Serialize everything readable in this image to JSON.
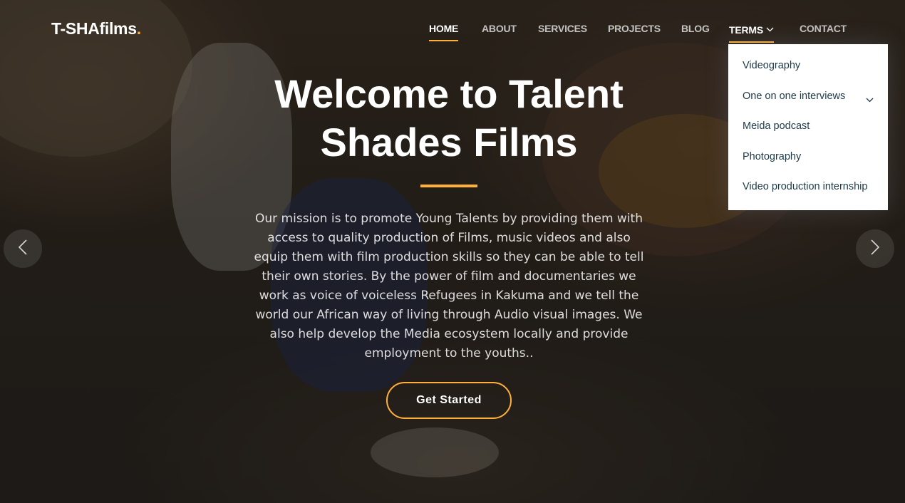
{
  "brand": {
    "name": "T-SHAfilms",
    "dot": ".",
    "accent": "#ffb03b"
  },
  "nav": {
    "items": [
      {
        "label": "HOME",
        "active": true
      },
      {
        "label": "ABOUT",
        "active": false
      },
      {
        "label": "SERVICES",
        "active": false
      },
      {
        "label": "PROJECTS",
        "active": false
      },
      {
        "label": "BLOG",
        "active": false
      },
      {
        "label": "TERMS",
        "active": false,
        "dropdown": true
      },
      {
        "label": "CONTACT",
        "active": false
      }
    ]
  },
  "dropdown": {
    "items": [
      {
        "label": "Videography"
      },
      {
        "label": "One on one interviews",
        "has_submenu": true
      },
      {
        "label": "Meida podcast"
      },
      {
        "label": "Photography"
      },
      {
        "label": "Video production internship"
      }
    ]
  },
  "hero": {
    "title_line1": "Welcome to Talent",
    "title_line2": "Shades Films",
    "mission": "Our mission is to promote Young Talents by providing them with access to quality production of Films, music videos and also equip them with film production skills so they can be able to tell their own stories. By the power of film and documentaries we work as voice of voiceless Refugees in Kakuma and we tell the world our African way of living through Audio visual images. We also help develop the Media ecosystem locally and provide employment to the youths..",
    "cta_label": "Get Started"
  },
  "carousel": {
    "prev_icon": "chevron-left-icon",
    "next_icon": "chevron-right-icon"
  }
}
